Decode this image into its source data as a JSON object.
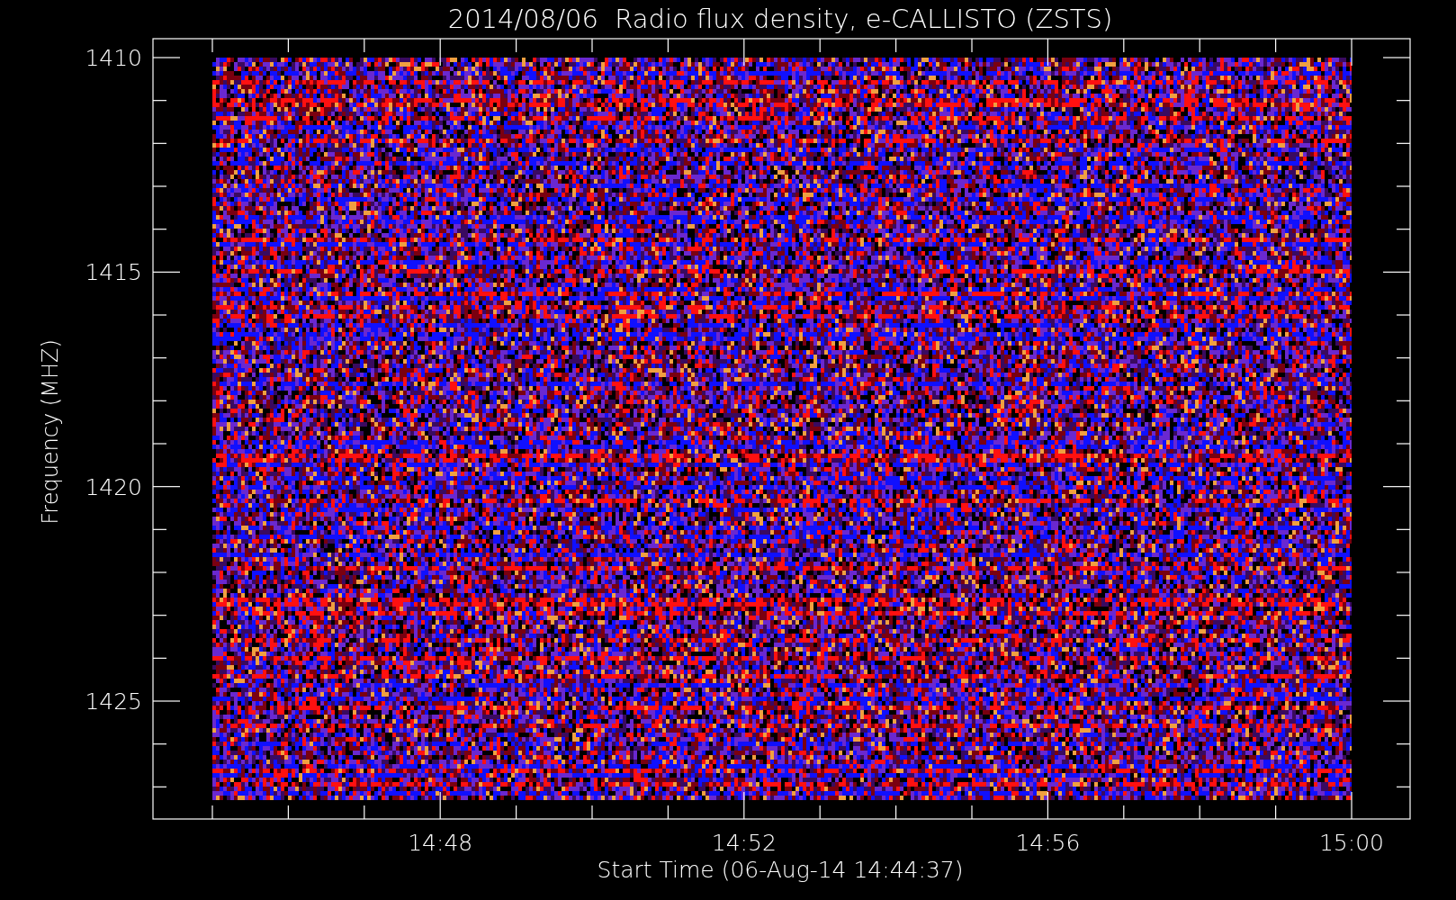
{
  "title": "2014/08/06  Radio flux density, e-CALLISTO (ZSTS)",
  "y_axis": {
    "label": "Frequency (MHZ)",
    "ticks": [
      "1410",
      "1415",
      "1420",
      "1425"
    ]
  },
  "x_axis": {
    "label": "Start Time (06-Aug-14 14:44:37)",
    "ticks": [
      "14:48",
      "14:52",
      "14:56",
      "15:00"
    ]
  }
}
